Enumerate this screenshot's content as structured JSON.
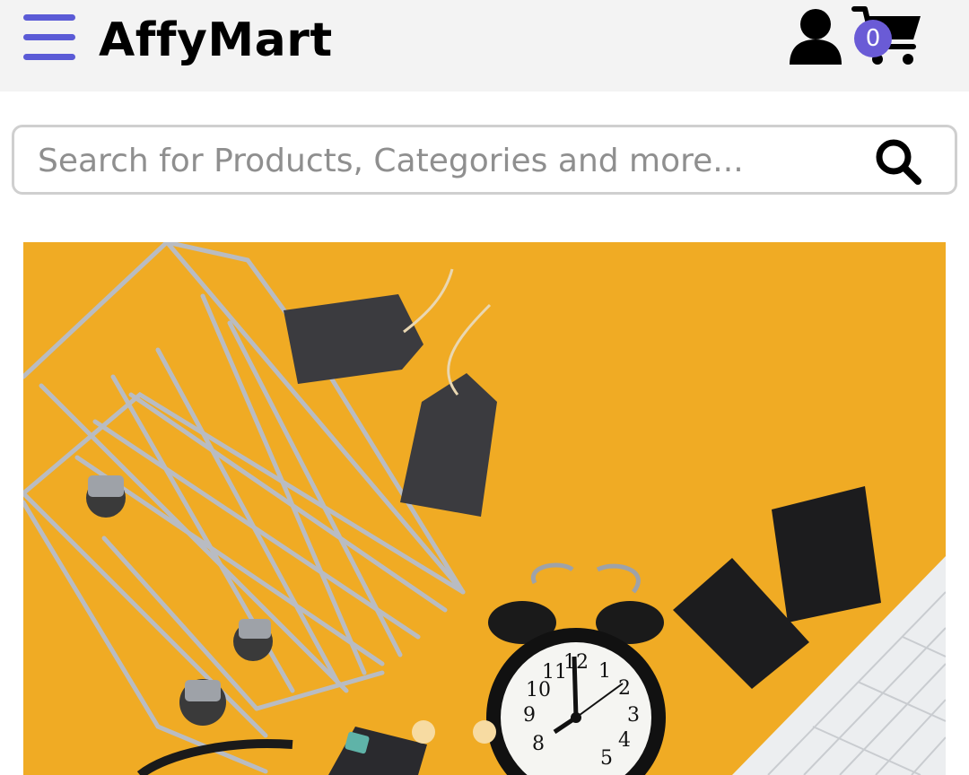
{
  "colors": {
    "accent": "#5b5bd6",
    "badge": "#6a5bd6",
    "banner_bg": "#f0ab24"
  },
  "header": {
    "menu_icon": "hamburger-menu-icon",
    "brand": "AffyMart",
    "user_icon": "user-account-icon",
    "cart_icon": "shopping-cart-icon",
    "cart_count": "0"
  },
  "search": {
    "placeholder": "Search for Products, Categories and more...",
    "value": "",
    "icon": "search-icon"
  },
  "carousel": {
    "slide_image": "shopping cart, price tags, alarm clock and keyboard on yellow background",
    "slide_count": 2,
    "active_index": 0,
    "clock_numbers": [
      "12",
      "1",
      "2",
      "3",
      "4",
      "5",
      "8",
      "9",
      "10",
      "11"
    ]
  }
}
